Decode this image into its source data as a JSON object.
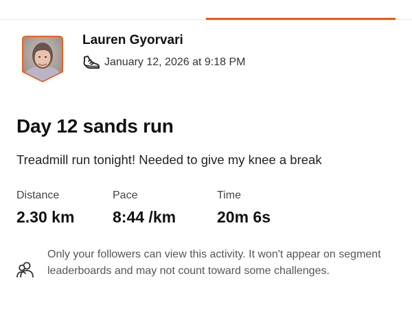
{
  "athlete": {
    "name": "Lauren Gyorvari",
    "date_time": "January 12, 2026 at 9:18 PM",
    "avatar_icon": "user-avatar-photo",
    "sport_icon": "run-shoe-icon"
  },
  "activity": {
    "title": "Day 12 sands run",
    "description": "Treadmill run tonight! Needed to give my knee a break"
  },
  "stats": [
    {
      "label": "Distance",
      "value": "2.30 km"
    },
    {
      "label": "Pace",
      "value": "8:44 /km"
    },
    {
      "label": "Time",
      "value": "20m 6s"
    }
  ],
  "privacy": {
    "icon": "followers-icon",
    "text": "Only your followers can view this activity. It won't appear on segment leaderboards and may not count toward some challenges."
  },
  "colors": {
    "accent": "#fc5200"
  }
}
